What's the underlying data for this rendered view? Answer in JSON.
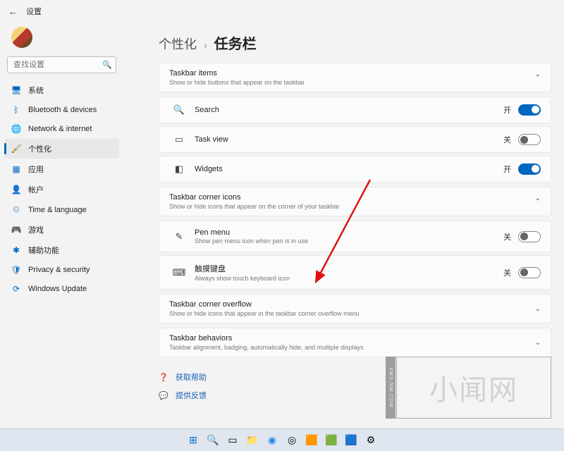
{
  "header": {
    "title": "设置"
  },
  "search": {
    "placeholder": "查找设置"
  },
  "nav": [
    {
      "icon": "🖥",
      "label": "系统",
      "color": "#0067c0"
    },
    {
      "icon": "ᛒ",
      "label": "Bluetooth & devices",
      "color": "#0067c0"
    },
    {
      "icon": "🌐",
      "label": "Network & internet",
      "color": "#0067c0"
    },
    {
      "icon": "🖌",
      "label": "个性化",
      "color": "#8a6b00",
      "active": true
    },
    {
      "icon": "▦",
      "label": "应用",
      "color": "#0067c0"
    },
    {
      "icon": "👤",
      "label": "帐户",
      "color": "#0067c0"
    },
    {
      "icon": "⏲",
      "label": "Time & language",
      "color": "#0067c0"
    },
    {
      "icon": "🎮",
      "label": "游戏",
      "color": "#0067c0"
    },
    {
      "icon": "✱",
      "label": "辅助功能",
      "color": "#0067c0"
    },
    {
      "icon": "🛡",
      "label": "Privacy & security",
      "color": "#0067c0"
    },
    {
      "icon": "⟳",
      "label": "Windows Update",
      "color": "#0067c0"
    }
  ],
  "breadcrumb": {
    "parent": "个性化",
    "sep": "›",
    "current": "任务栏"
  },
  "sections": {
    "items": {
      "title": "Taskbar items",
      "sub": "Show or hide buttons that appear on the taskbar",
      "rows": [
        {
          "icon": "🔍",
          "label": "Search",
          "state": "开",
          "on": true
        },
        {
          "icon": "▭",
          "label": "Task view",
          "state": "关",
          "on": false
        },
        {
          "icon": "◧",
          "label": "Widgets",
          "state": "开",
          "on": true
        }
      ]
    },
    "corner": {
      "title": "Taskbar corner icons",
      "sub": "Show or hide icons that appear on the corner of your taskbar",
      "rows": [
        {
          "icon": "✎",
          "label": "Pen menu",
          "sub": "Show pen menu icon when pen is in use",
          "state": "关",
          "on": false
        },
        {
          "icon": "⌨",
          "label": "触摸键盘",
          "sub": "Always show touch keyboard icon",
          "state": "关",
          "on": false
        }
      ]
    },
    "overflow": {
      "title": "Taskbar corner overflow",
      "sub": "Show or hide icons that appear in the taskbar corner overflow menu"
    },
    "behaviors": {
      "title": "Taskbar behaviors",
      "sub": "Taskbar alignment, badging, automatically hide, and multiple displays"
    }
  },
  "help": {
    "get": "获取帮助",
    "feedback": "提供反馈"
  },
  "watermark": "小闻网",
  "watermark_side": "XWS.NW.COM"
}
